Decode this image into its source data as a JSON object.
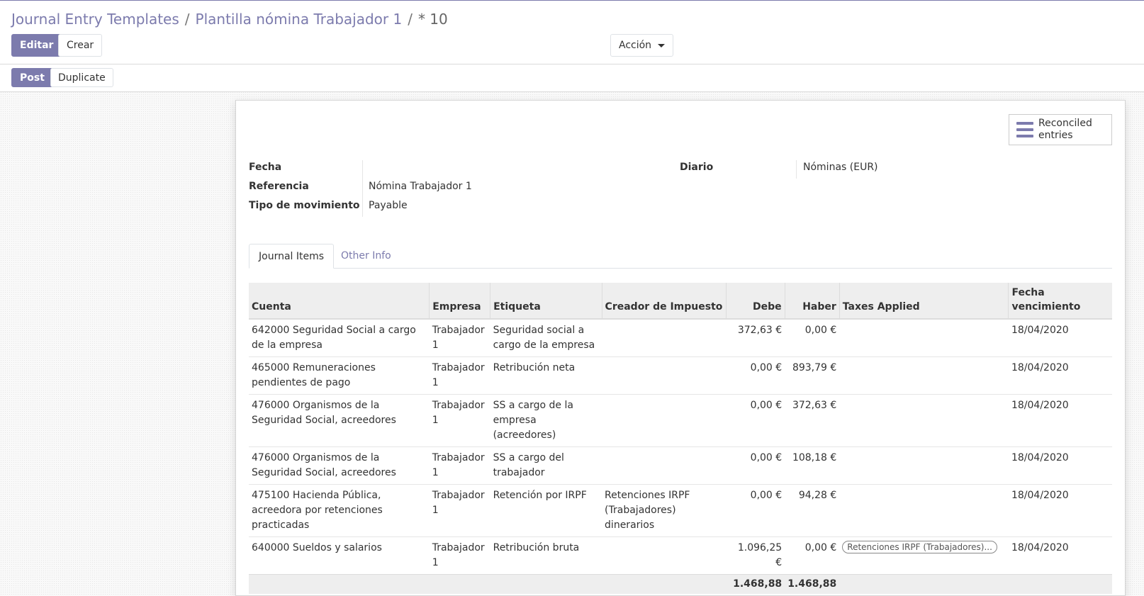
{
  "breadcrumb": {
    "root": "Journal Entry Templates",
    "parent": "Plantilla nómina Trabajador 1",
    "current": "* 10",
    "separator": "/"
  },
  "toolbar": {
    "edit_label": "Editar",
    "create_label": "Crear",
    "action_label": "Acción"
  },
  "statusbar": {
    "post_label": "Post",
    "duplicate_label": "Duplicate"
  },
  "smart_button": {
    "label": "Reconciled entries",
    "icon": "list-icon"
  },
  "fields": {
    "fecha_label": "Fecha",
    "fecha_value": "",
    "referencia_label": "Referencia",
    "referencia_value": "Nómina Trabajador 1",
    "tipo_label": "Tipo de movimiento",
    "tipo_value": "Payable",
    "diario_label": "Diario",
    "diario_value": "Nóminas (EUR)"
  },
  "tabs": [
    {
      "label": "Journal Items",
      "active": true
    },
    {
      "label": "Other Info",
      "active": false
    }
  ],
  "table": {
    "headers": {
      "cuenta": "Cuenta",
      "empresa": "Empresa",
      "etiqueta": "Etiqueta",
      "creador": "Creador de Impuesto",
      "debe": "Debe",
      "haber": "Haber",
      "taxes": "Taxes Applied",
      "fecha_venc": "Fecha vencimiento"
    },
    "rows": [
      {
        "cuenta": "642000 Seguridad Social a cargo de la empresa",
        "empresa": "Trabajador 1",
        "etiqueta": "Seguridad social a cargo de la empresa",
        "creador": "",
        "debe": "372,63 €",
        "haber": "0,00 €",
        "taxes": "",
        "fecha": "18/04/2020"
      },
      {
        "cuenta": "465000 Remuneraciones pendientes de pago",
        "empresa": "Trabajador 1",
        "etiqueta": "Retribución neta",
        "creador": "",
        "debe": "0,00 €",
        "haber": "893,79 €",
        "taxes": "",
        "fecha": "18/04/2020"
      },
      {
        "cuenta": "476000 Organismos de la Seguridad Social, acreedores",
        "empresa": "Trabajador 1",
        "etiqueta": "SS a cargo de la empresa (acreedores)",
        "creador": "",
        "debe": "0,00 €",
        "haber": "372,63 €",
        "taxes": "",
        "fecha": "18/04/2020"
      },
      {
        "cuenta": "476000 Organismos de la Seguridad Social, acreedores",
        "empresa": "Trabajador 1",
        "etiqueta": "SS a cargo del trabajador",
        "creador": "",
        "debe": "0,00 €",
        "haber": "108,18 €",
        "taxes": "",
        "fecha": "18/04/2020"
      },
      {
        "cuenta": "475100 Hacienda Pública, acreedora por retenciones practicadas",
        "empresa": "Trabajador 1",
        "etiqueta": "Retención por IRPF",
        "creador": "Retenciones IRPF (Trabajadores) dinerarios",
        "debe": "0,00 €",
        "haber": "94,28 €",
        "taxes": "",
        "fecha": "18/04/2020"
      },
      {
        "cuenta": "640000 Sueldos y salarios",
        "empresa": "Trabajador 1",
        "etiqueta": "Retribución bruta",
        "creador": "",
        "debe": "1.096,25 €",
        "haber": "0,00 €",
        "taxes": "Retenciones IRPF (Trabajadores)...",
        "fecha": "18/04/2020"
      }
    ],
    "totals": {
      "debe": "1.468,88",
      "haber": "1.468,88"
    }
  },
  "colors": {
    "accent": "#7c7bad"
  }
}
